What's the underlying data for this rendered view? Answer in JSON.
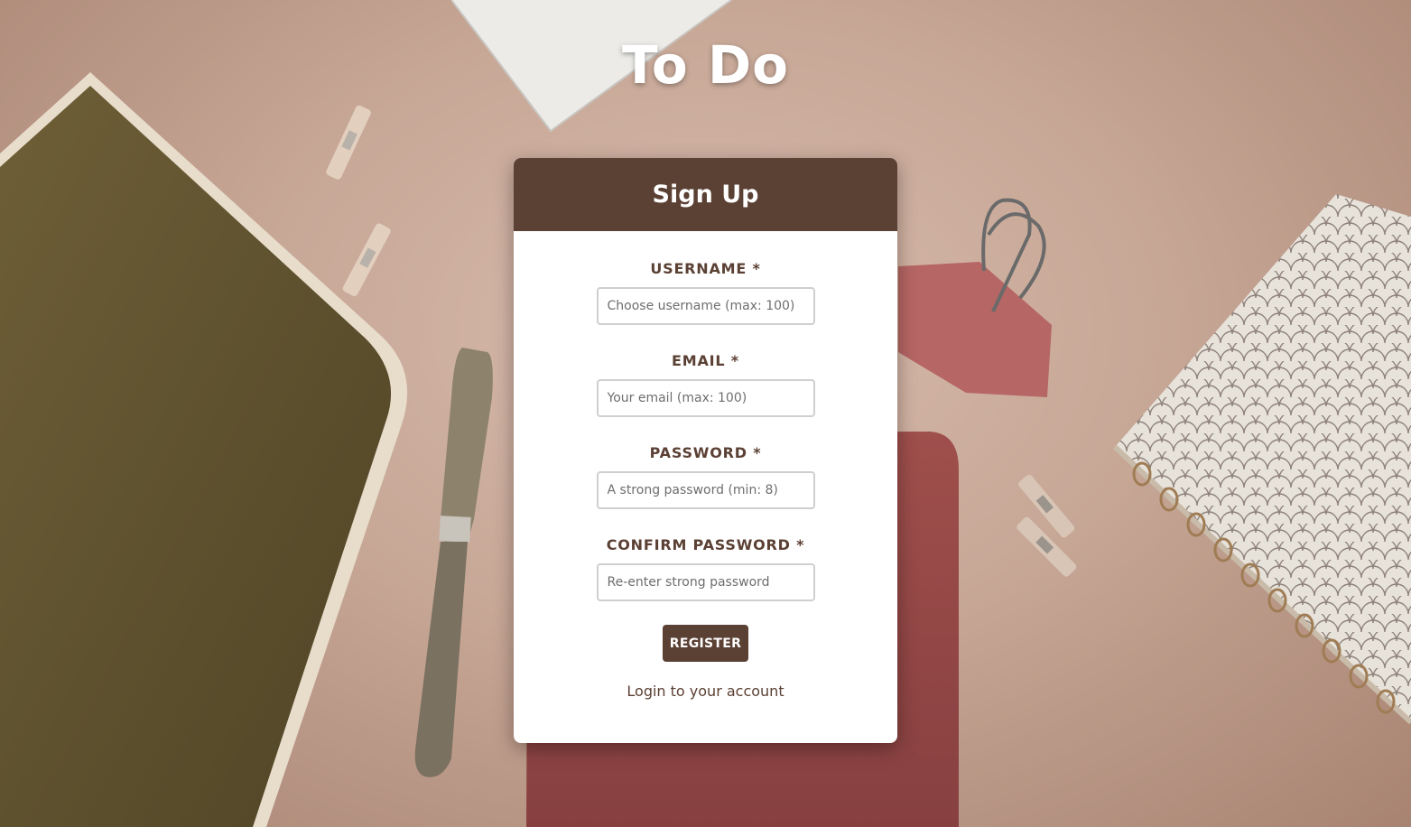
{
  "app": {
    "title": "To Do"
  },
  "signup_card": {
    "heading": "Sign Up",
    "fields": [
      {
        "label": "USERNAME *",
        "placeholder": "Choose username (max: 100)",
        "value": ""
      },
      {
        "label": "EMAIL *",
        "placeholder": "Your email (max: 100)",
        "value": ""
      },
      {
        "label": "PASSWORD *",
        "placeholder": "A strong password (min: 8)",
        "value": ""
      },
      {
        "label": "CONFIRM PASSWORD *",
        "placeholder": "Re-enter strong password",
        "value": ""
      }
    ],
    "register_label": "REGISTER",
    "login_link": "Login to your account"
  },
  "colors": {
    "accent": "#5b4034",
    "background": "#c7a796",
    "card": "#ffffff"
  }
}
